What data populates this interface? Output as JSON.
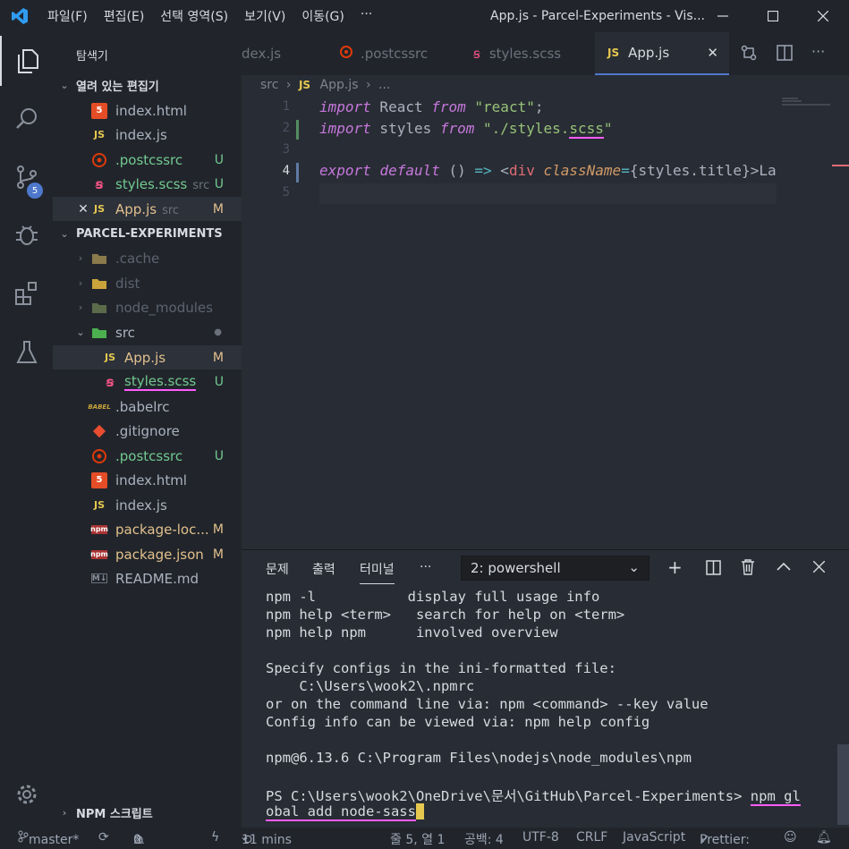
{
  "titlebar": {
    "menu": [
      "파일(F)",
      "편집(E)",
      "선택 영역(S)",
      "보기(V)",
      "이동(G)",
      "···"
    ],
    "title": "App.js - Parcel-Experiments - Vis..."
  },
  "activity": {
    "scm_badge": "5"
  },
  "sidebar": {
    "title": "탐색기",
    "open_editors_header": "열려 있는 편집기",
    "open_editors": [
      {
        "name": "index.html",
        "icon": "html5-icon"
      },
      {
        "name": "index.js",
        "icon": "js-icon",
        "icon_text": "JS"
      },
      {
        "name": ".postcssrc",
        "icon": "postcss-icon",
        "status": "U"
      },
      {
        "name": "styles.scss",
        "icon": "sass-icon",
        "dir": "src",
        "status": "U"
      },
      {
        "name": "App.js",
        "icon": "js-icon",
        "icon_text": "JS",
        "dir": "src",
        "status": "M"
      }
    ],
    "project_header": "PARCEL-EXPERIMENTS",
    "tree": [
      {
        "name": ".cache"
      },
      {
        "name": "dist"
      },
      {
        "name": "node_modules"
      },
      {
        "name": "src"
      },
      {
        "name": "App.js",
        "icon_text": "JS",
        "status": "M"
      },
      {
        "name": "styles.scss",
        "status": "U"
      },
      {
        "name": ".babelrc",
        "icon_text": "BABEL"
      },
      {
        "name": ".gitignore"
      },
      {
        "name": ".postcssrc",
        "status": "U"
      },
      {
        "name": "index.html"
      },
      {
        "name": "index.js",
        "icon_text": "JS"
      },
      {
        "name": "package-loc...",
        "icon_text": "npm",
        "status": "M"
      },
      {
        "name": "package.json",
        "icon_text": "npm",
        "status": "M"
      },
      {
        "name": "README.md",
        "icon_text": "M↓"
      }
    ],
    "npm_scripts": "NPM 스크립트"
  },
  "tabs": [
    {
      "label": "dex.js"
    },
    {
      "label": ".postcssrc"
    },
    {
      "label": "styles.scss"
    },
    {
      "label": "App.js",
      "icon_text": "JS"
    }
  ],
  "breadcrumb": {
    "folder": "src",
    "file_icon": "JS",
    "file": "App.js",
    "more": "..."
  },
  "editor": {
    "line_numbers": [
      "1",
      "2",
      "3",
      "4",
      "5"
    ],
    "line1": {
      "kw1": "import",
      "name": " React ",
      "kw2": "from",
      "str": "\"react\"",
      "end": ";"
    },
    "line2": {
      "kw1": "import",
      "name": " styles ",
      "kw2": "from",
      "str_a": "\"./styles.",
      "str_b": "scss",
      "str_c": "\""
    },
    "line4": {
      "kw1": "export",
      "kw2": "default",
      "sig": " () ",
      "arrow": "=>",
      "lt": " <",
      "tag": "div",
      "attr": "className",
      "eq": "=",
      "expr": "{styles.title}",
      "rest": ">La"
    }
  },
  "panel": {
    "tabs": [
      "문제",
      "출력",
      "터미널",
      "···"
    ],
    "terminal_select": "2: powershell",
    "terminal_lines": [
      "npm -l           display full usage info",
      "npm help <term>   search for help on <term>",
      "npm help npm      involved overview",
      "",
      "Specify configs in the ini-formatted file:",
      "    C:\\Users\\wook2\\.npmrc",
      "or on the command line via: npm <command> --key value",
      "Config info can be viewed via: npm help config",
      "",
      "npm@6.13.6 C:\\Program Files\\nodejs\\node_modules\\npm",
      ""
    ],
    "prompt": "PS C:\\Users\\wook2\\OneDrive\\문서\\GitHub\\Parcel-Experiments> ",
    "cmd_a": "npm gl",
    "cmd_b": "obal add node-sass"
  },
  "statusbar": {
    "branch": "master*",
    "errors": "0",
    "warnings": "0",
    "time": "11 mins",
    "position": "줄 5, 열 1",
    "spaces": "공백: 4",
    "encoding": "UTF-8",
    "eol": "CRLF",
    "language": "JavaScript",
    "prettier": "Prettier: "
  },
  "colors": {
    "accent": "#4d78cc",
    "highlight": "#ff5cff",
    "modified": "#e2c08d",
    "untracked": "#73c991"
  }
}
